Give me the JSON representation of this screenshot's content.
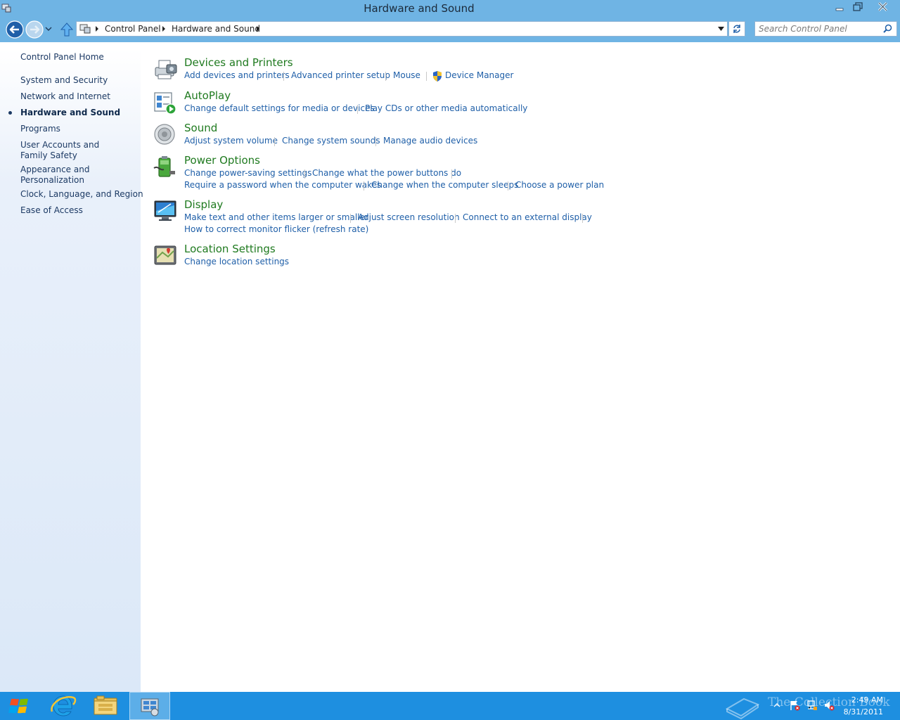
{
  "window": {
    "title": "Hardware and Sound"
  },
  "address_bar": {
    "crumbs": [
      "Control Panel",
      "Hardware and Sound"
    ]
  },
  "search": {
    "placeholder": "Search Control Panel"
  },
  "sidebar": {
    "home": "Control Panel Home",
    "items": [
      "System and Security",
      "Network and Internet",
      "Hardware and Sound",
      "Programs",
      "User Accounts and Family Safety",
      "Appearance and Personalization",
      "Clock, Language, and Region",
      "Ease of Access"
    ],
    "current": "Hardware and Sound"
  },
  "categories": [
    {
      "title": "Devices and Printers",
      "icon": "printer-icon",
      "tasks": [
        "Add devices and printers",
        "Advanced printer setup",
        "Mouse",
        "Device Manager"
      ]
    },
    {
      "title": "AutoPlay",
      "icon": "autoplay-icon",
      "tasks": [
        "Change default settings for media or devices",
        "Play CDs or other media automatically"
      ]
    },
    {
      "title": "Sound",
      "icon": "speaker-icon",
      "tasks": [
        "Adjust system volume",
        "Change system sounds",
        "Manage audio devices"
      ]
    },
    {
      "title": "Power Options",
      "icon": "battery-icon",
      "tasks": [
        "Change power-saving settings",
        "Change what the power buttons do",
        "Require a password when the computer wakes",
        "Change when the computer sleeps",
        "Choose a power plan"
      ]
    },
    {
      "title": "Display",
      "icon": "monitor-icon",
      "tasks": [
        "Make text and other items larger or smaller",
        "Adjust screen resolution",
        "Connect to an external display",
        "How to correct monitor flicker (refresh rate)"
      ]
    },
    {
      "title": "Location Settings",
      "icon": "location-icon",
      "tasks": [
        "Change location settings"
      ]
    }
  ],
  "taskbar": {
    "items": [
      "start-button",
      "internet-explorer",
      "file-explorer",
      "control-panel"
    ],
    "watermark": "The Collection Book",
    "time": "2:49 AM",
    "date": "8/31/2011"
  },
  "colors": {
    "chrome": "#6fb4e4",
    "taskbar": "#1e8fe0",
    "category_title": "#1f7a1f",
    "task_link": "#1f5fa8"
  }
}
